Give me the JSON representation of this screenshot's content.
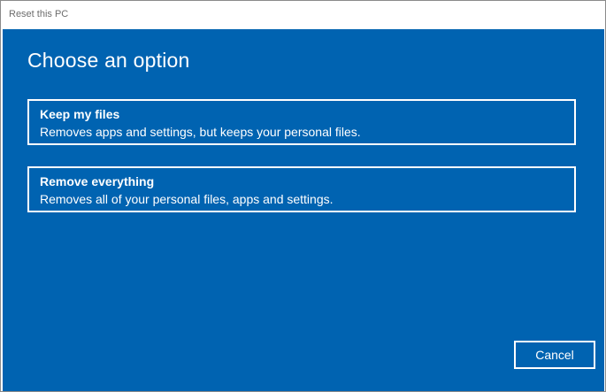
{
  "window": {
    "title": "Reset this PC"
  },
  "main": {
    "heading": "Choose an option",
    "options": [
      {
        "title": "Keep my files",
        "description": "Removes apps and settings, but keeps your personal files."
      },
      {
        "title": "Remove everything",
        "description": "Removes all of your personal files, apps and settings."
      }
    ],
    "cancel_label": "Cancel"
  },
  "colors": {
    "background": "#0063b1",
    "text": "#ffffff",
    "titlebar": "#ffffff"
  }
}
